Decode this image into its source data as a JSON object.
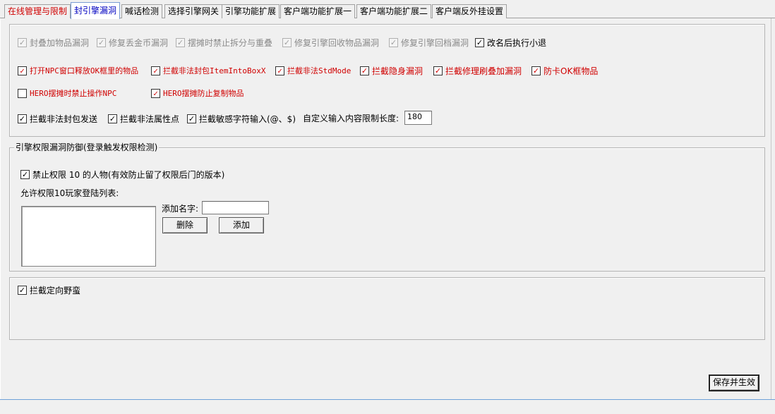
{
  "tabs": [
    {
      "label": "在线管理与限制",
      "style": "red"
    },
    {
      "label": "封引擎漏洞",
      "style": "active"
    },
    {
      "label": "喊话检测",
      "style": ""
    },
    {
      "label": "选择引擎网关",
      "style": ""
    },
    {
      "label": "引擎功能扩展",
      "style": ""
    },
    {
      "label": "客户端功能扩展一",
      "style": ""
    },
    {
      "label": "客户端功能扩展二",
      "style": ""
    },
    {
      "label": "客户端反外挂设置",
      "style": ""
    }
  ],
  "options": {
    "row1": [
      {
        "label": "封叠加物品漏洞",
        "checked": true,
        "enabled": false
      },
      {
        "label": "修复丢金币漏洞",
        "checked": true,
        "enabled": false
      },
      {
        "label": "摆摊时禁止拆分与重叠",
        "checked": true,
        "enabled": false
      },
      {
        "label": "修复引擎回收物品漏洞",
        "checked": true,
        "enabled": false
      },
      {
        "label": "修复引擎回档漏洞",
        "checked": true,
        "enabled": false
      },
      {
        "label": "改名后执行小退",
        "checked": true,
        "enabled": true
      }
    ],
    "row2": [
      {
        "label": "打开NPC窗口释放OK框里的物品",
        "checked": true
      },
      {
        "label": "拦截非法封包ItemIntoBoxX",
        "checked": true
      },
      {
        "label": "拦截非法StdMode",
        "checked": true
      },
      {
        "label": "拦截隐身漏洞",
        "checked": true
      },
      {
        "label": "拦截修理刷叠加漏洞",
        "checked": true
      },
      {
        "label": "防卡OK框物品",
        "checked": true
      }
    ],
    "row3": [
      {
        "label": "HERO摆摊时禁止操作NPC",
        "checked": false
      },
      {
        "label": "HERO摆摊防止复制物品",
        "checked": true
      }
    ],
    "row4": [
      {
        "label": "拦截非法封包发送",
        "checked": true
      },
      {
        "label": "拦截非法属性点",
        "checked": true
      },
      {
        "label": "拦截敏感字符输入(@、$)",
        "checked": true
      }
    ],
    "custom_length_label": "自定义输入内容限制长度:",
    "custom_length_value": "180"
  },
  "permission": {
    "title": "引擎权限漏洞防御(登录触发权限检测)",
    "forbid_label": "禁止权限 10 的人物(有效防止留了权限后门的版本)",
    "forbid_checked": true,
    "allow_list_label": "允许权限10玩家登陆列表:",
    "add_name_label": "添加名字:",
    "add_name_value": "",
    "delete_button": "删除",
    "add_button": "添加"
  },
  "wild": {
    "label": "拦截定向野蛮",
    "checked": true
  },
  "save_button": "保存并生效"
}
